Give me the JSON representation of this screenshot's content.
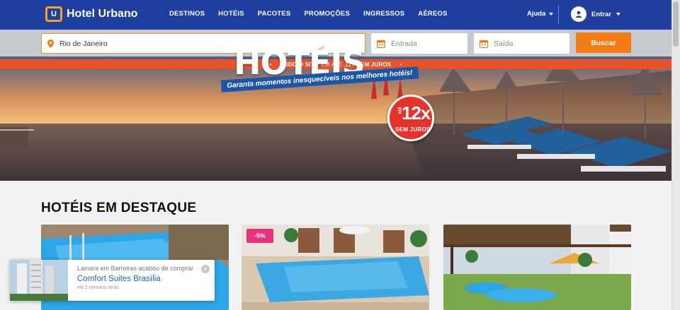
{
  "header": {
    "logo_text": "Hotel Urbano",
    "logo_mark": "U",
    "nav": [
      "DESTINOS",
      "HOTÉIS",
      "PACOTES",
      "PROMOÇÕES",
      "INGRESSOS",
      "AÉREOS"
    ],
    "help_label": "Ajuda",
    "login_label": "Entrar"
  },
  "search": {
    "destination_value": "Rio de Janeiro",
    "checkin_placeholder": "Entrada",
    "checkout_placeholder": "Saída",
    "button_label": "Buscar"
  },
  "promo_strip": {
    "part1": "TODO O SITE",
    "part2": "EM ATÉ",
    "part3": "12x SEM JUROS"
  },
  "banner": {
    "title": "HOTÉIS",
    "subtitle": "Garanta momentos inesquecíveis nos melhores hotéis!",
    "badge_top": "até",
    "badge_big": "12x",
    "badge_bottom": "SEM JUROS"
  },
  "featured": {
    "title": "HOTÉIS EM DESTAQUE",
    "discount_badge": "-5%"
  },
  "toast": {
    "line": "Lainara em Barreiras acabou de comprar",
    "hotel": "Comfort Suites Brasília",
    "time": "Há 2 minutos atrás",
    "close": "×"
  },
  "colors": {
    "header_blue": "#1f3fa0",
    "accent_orange": "#f47c12",
    "promo_red": "#e8532c",
    "link_blue": "#1c66c2",
    "discount_pink": "#e7317a"
  },
  "icons": [
    "pin-icon",
    "calendar-icon",
    "user-icon",
    "chevron-down-icon",
    "close-icon"
  ]
}
